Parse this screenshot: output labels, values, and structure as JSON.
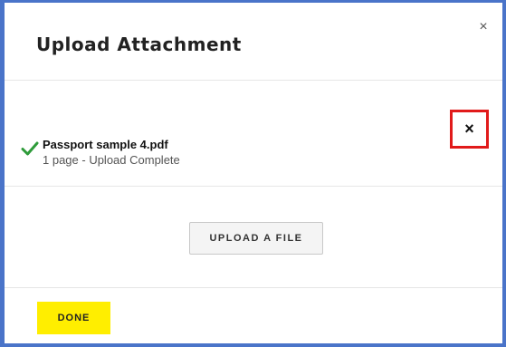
{
  "dialog": {
    "title": "Upload Attachment",
    "close_icon": "close-icon",
    "close_glyph": "×"
  },
  "file": {
    "name": "Passport sample 4.pdf",
    "status": "1 page - Upload Complete",
    "status_icon": "check-icon",
    "remove_icon": "close-icon",
    "remove_glyph": "×"
  },
  "actions": {
    "upload_label": "UPLOAD A FILE",
    "done_label": "DONE"
  },
  "colors": {
    "frame_border": "#4a74c9",
    "check": "#2e9b3a",
    "highlight": "#e11a1a",
    "done_button": "#ffee00"
  }
}
